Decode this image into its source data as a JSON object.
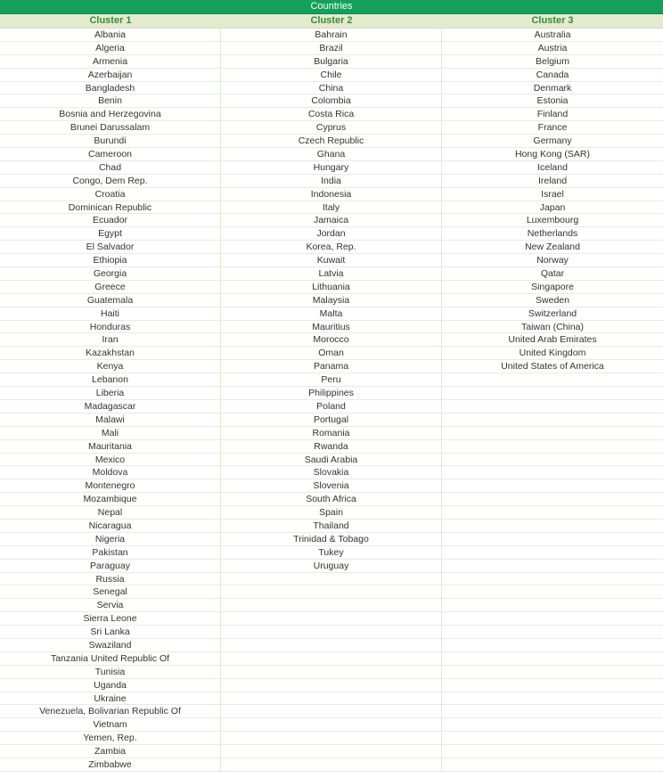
{
  "table": {
    "title": "Countries",
    "accent_color": "#14a05a",
    "header_bg": "#e3ebcf",
    "header_text_color": "#3a8a3a",
    "total_rows": 56,
    "columns": [
      {
        "header": "Cluster 1",
        "items": [
          "Albania",
          "Algeria",
          "Armenia",
          "Azerbaijan",
          "Bangladesh",
          "Benin",
          "Bosnia and Herzegovina",
          "Brunei Darussalam",
          "Burundi",
          "Cameroon",
          "Chad",
          "Congo, Dem Rep.",
          "Croatia",
          "Dominican Republic",
          "Ecuador",
          "Egypt",
          "El Salvador",
          "Ethiopia",
          "Georgia",
          "Greece",
          "Guatemala",
          "Haiti",
          "Honduras",
          "Iran",
          "Kazakhstan",
          "Kenya",
          "Lebanon",
          "Liberia",
          "Madagascar",
          "Malawi",
          "Mali",
          "Mauritania",
          "Mexico",
          "Moldova",
          "Montenegro",
          "Mozambique",
          "Nepal",
          "Nicaragua",
          "Nigeria",
          "Pakistan",
          "Paraguay",
          "Russia",
          "Senegal",
          "Servia",
          "Sierra Leone",
          "Sri Lanka",
          "Swaziland",
          "Tanzania United Republic Of",
          "Tunisia",
          "Uganda",
          "Ukraine",
          "Venezuela, Bolivarian Republic Of",
          "Vietnam",
          "Yemen, Rep.",
          "Zambia",
          "Zimbabwe"
        ]
      },
      {
        "header": "Cluster 2",
        "items": [
          "Bahrain",
          "Brazil",
          "Bulgaria",
          "Chile",
          "China",
          "Colombia",
          "Costa Rica",
          "Cyprus",
          "Czech Republic",
          "Ghana",
          "Hungary",
          "India",
          "Indonesia",
          "Italy",
          "Jamaica",
          "Jordan",
          "Korea, Rep.",
          "Kuwait",
          "Latvia",
          "Lithuania",
          "Malaysia",
          "Malta",
          "Mauritius",
          "Morocco",
          "Oman",
          "Panama",
          "Peru",
          "Philippines",
          "Poland",
          "Portugal",
          "Romania",
          "Rwanda",
          "Saudi Arabia",
          "Slovakia",
          "Slovenia",
          "South Africa",
          "Spain",
          "Thailand",
          "Trinidad & Tobago",
          "Tukey",
          "Uruguay"
        ]
      },
      {
        "header": "Cluster 3",
        "items": [
          "Australia",
          "Austria",
          "Belgium",
          "Canada",
          "Denmark",
          "Estonia",
          "Finland",
          "France",
          "Germany",
          "Hong Kong (SAR)",
          "Iceland",
          "Ireland",
          "Israel",
          "Japan",
          "Luxembourg",
          "Netherlands",
          "New Zealand",
          "Norway",
          "Qatar",
          "Singapore",
          "Sweden",
          "Switzerland",
          "Taiwan (China)",
          "United Arab Emirates",
          "United Kingdom",
          "United States of America"
        ]
      }
    ]
  }
}
